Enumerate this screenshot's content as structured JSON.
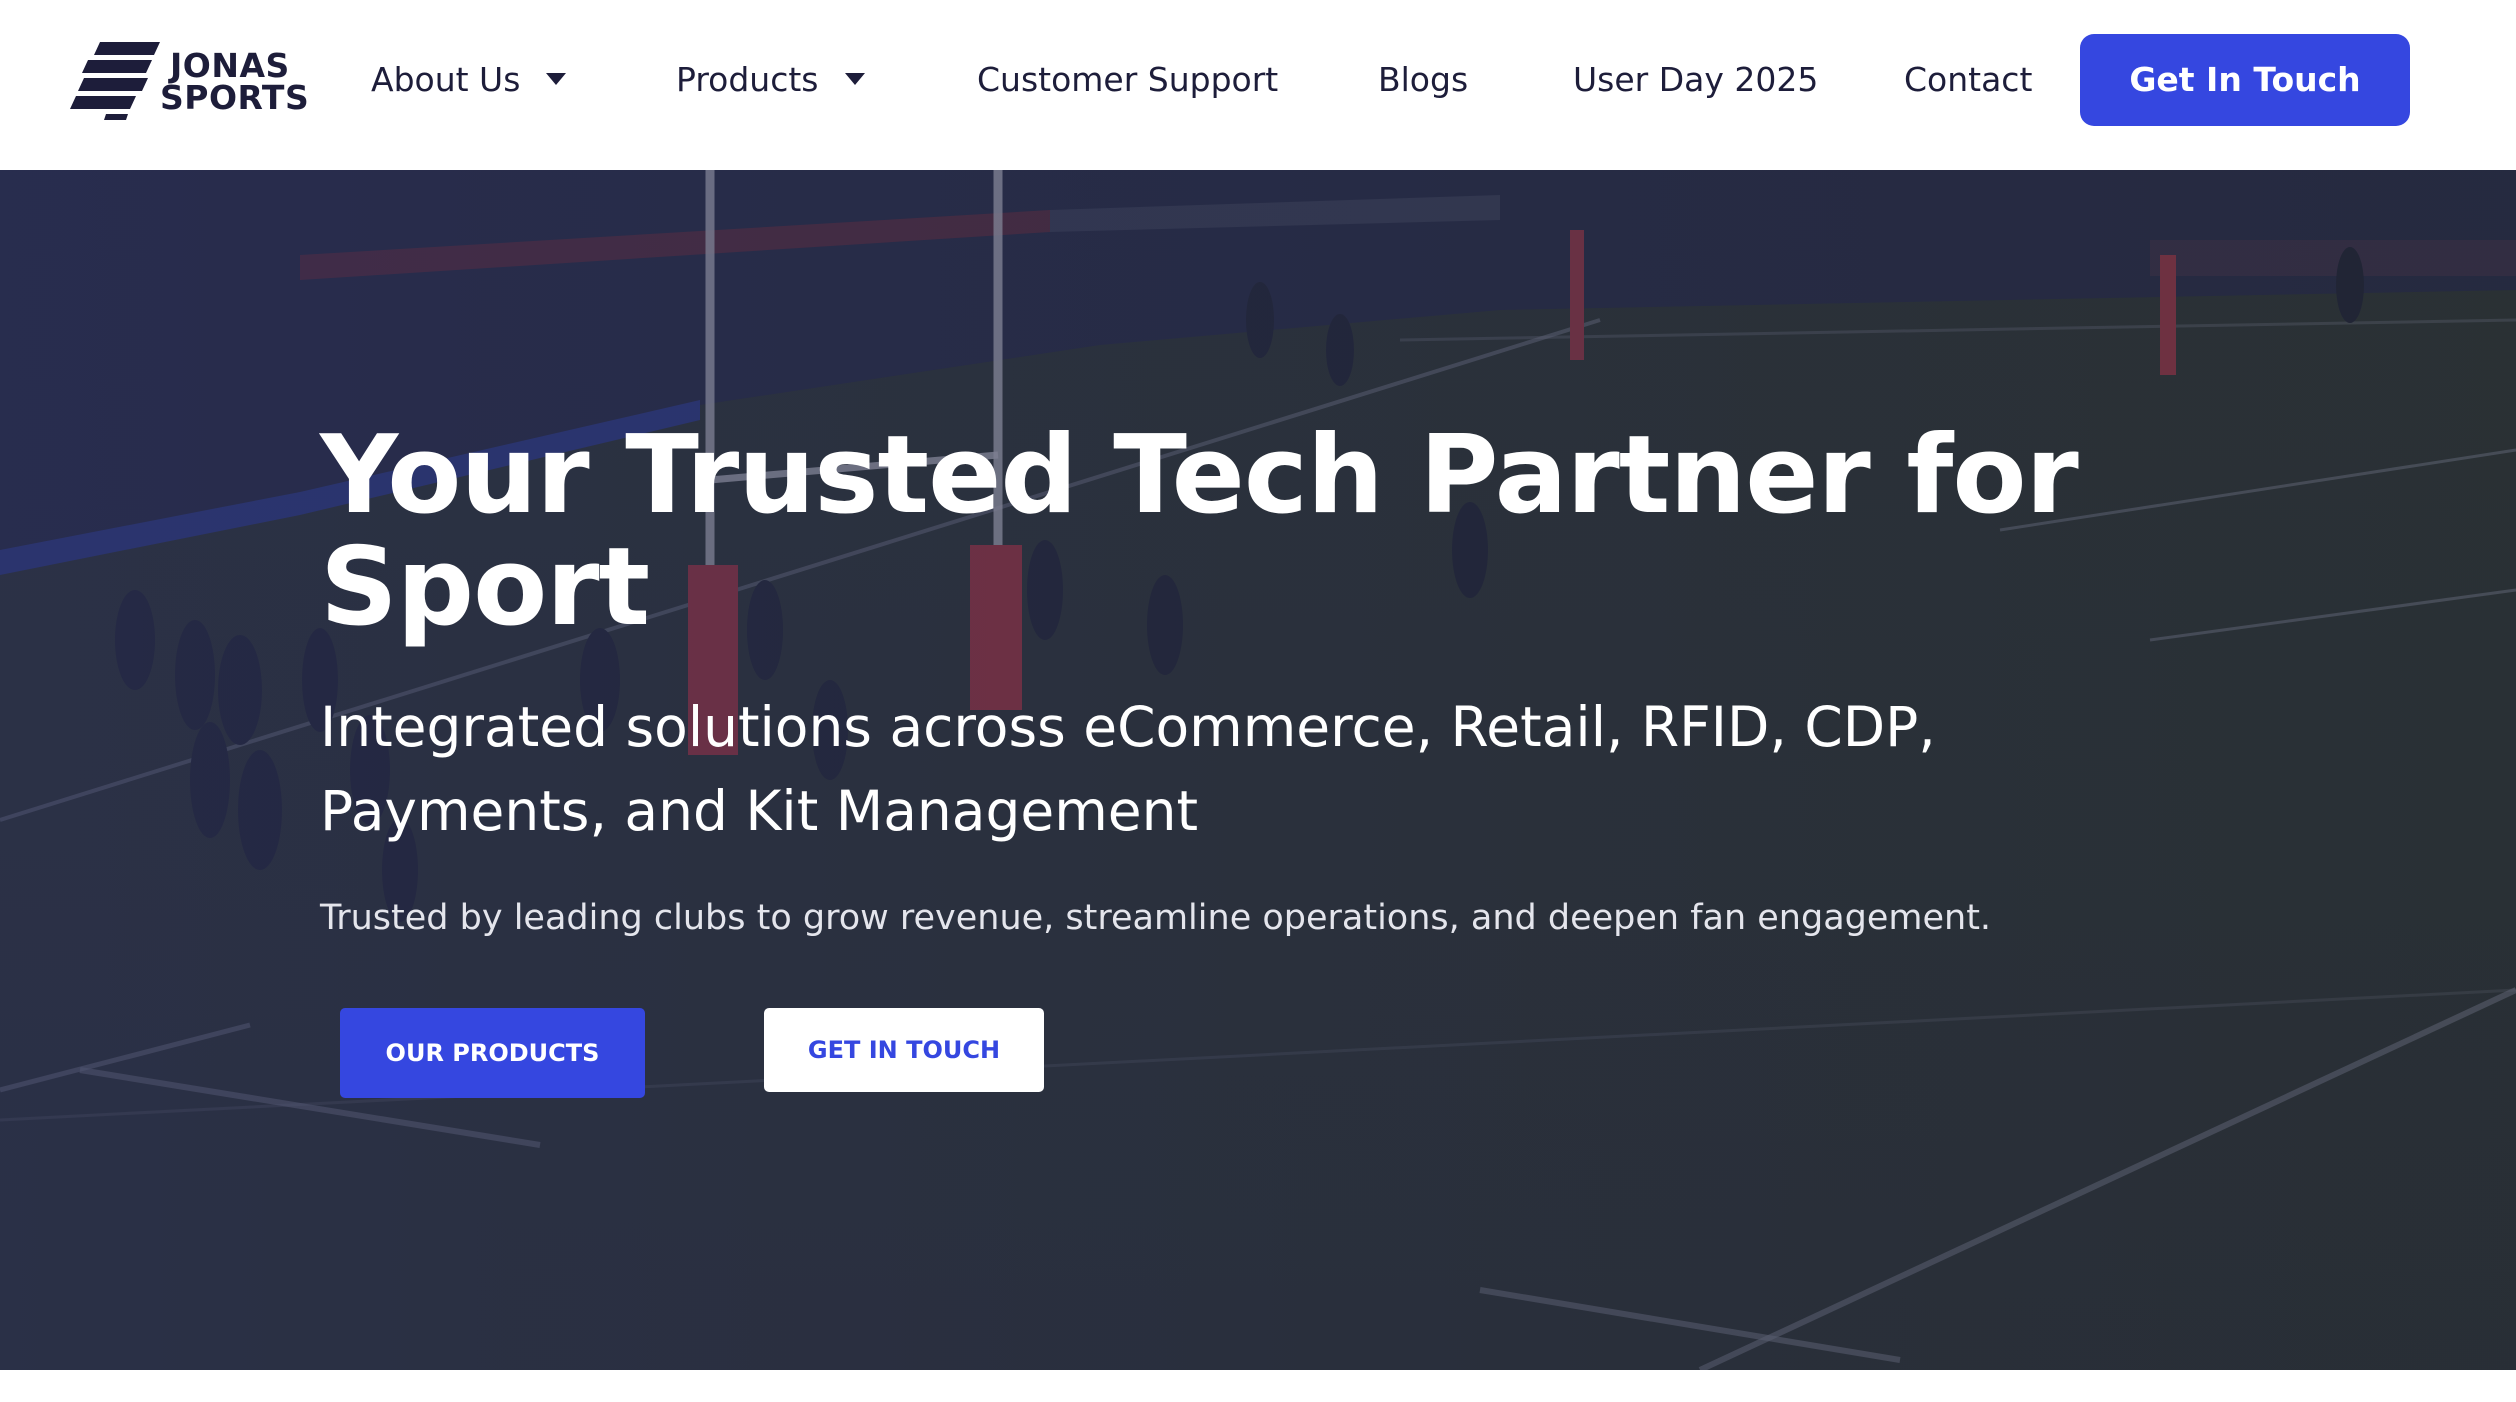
{
  "brand": {
    "name_line1": "JONAS",
    "name_line2": "SPORTS",
    "logo_icon": "striped-s-icon",
    "text_color": "#1d1d3a"
  },
  "nav": {
    "items": [
      {
        "label": "About Us",
        "has_dropdown": true
      },
      {
        "label": "Products",
        "has_dropdown": true
      },
      {
        "label": "Customer Support",
        "has_dropdown": false
      },
      {
        "label": "Blogs",
        "has_dropdown": false
      },
      {
        "label": "User Day 2025",
        "has_dropdown": false
      },
      {
        "label": "Contact",
        "has_dropdown": false
      }
    ],
    "cta_label": "Get In Touch",
    "dropdown_icon": "caret-down-icon"
  },
  "hero": {
    "title": "Your Trusted Tech Partner for Sport",
    "subtitle": "Integrated solutions across eCommerce, Retail, RFID, CDP, Payments, and Kit Management",
    "description": "Trusted by leading clubs to grow revenue, streamline operations, and deepen fan engagement.",
    "primary_button": "OUR PRODUCTS",
    "secondary_button": "GET IN TOUCH",
    "background": "rugby-stadium-photo"
  },
  "colors": {
    "accent": "#3547e0",
    "text_dark": "#1d1d3a",
    "hero_overlay": "#262a3c",
    "white": "#ffffff"
  }
}
